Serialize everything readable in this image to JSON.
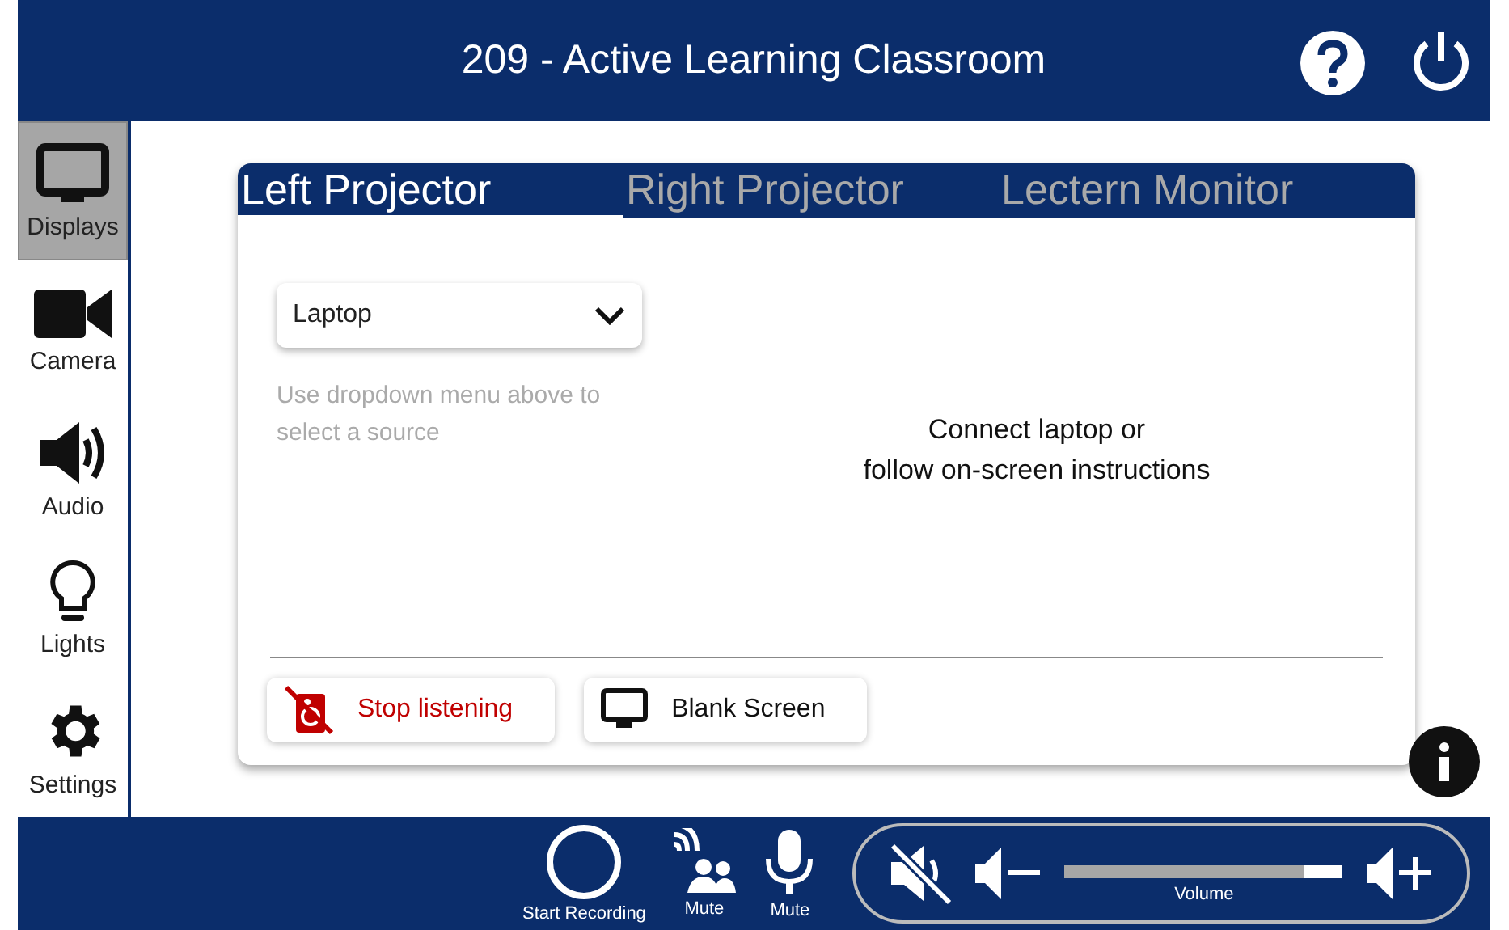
{
  "header": {
    "title": "209 - Active Learning Classroom"
  },
  "sidebar": {
    "items": [
      {
        "kind": "display",
        "label": "Displays",
        "selected": true
      },
      {
        "kind": "camera",
        "label": "Camera",
        "selected": false
      },
      {
        "kind": "audio",
        "label": "Audio",
        "selected": false
      },
      {
        "kind": "lights",
        "label": "Lights",
        "selected": false
      },
      {
        "kind": "settings",
        "label": "Settings",
        "selected": false
      }
    ]
  },
  "tabs": [
    {
      "label": "Left Projector",
      "selected": true
    },
    {
      "label": "Right Projector",
      "selected": false
    },
    {
      "label": "Lectern Monitor",
      "selected": false
    }
  ],
  "source": {
    "value": "Laptop",
    "hint": "Use dropdown menu above to select a source"
  },
  "message": [
    "Connect laptop or",
    "follow on-screen instructions"
  ],
  "actions": [
    {
      "kind": "stop-listening",
      "label": "Stop listening"
    },
    {
      "kind": "blank",
      "label": "Blank Screen"
    }
  ],
  "footer": {
    "controls": [
      {
        "kind": "record",
        "label": "Start Recording"
      },
      {
        "kind": "mute-room",
        "label": "Mute"
      },
      {
        "kind": "mute-mic",
        "label": "Mute"
      }
    ],
    "volume": {
      "label": "Volume",
      "level": 0.86,
      "muted": true
    }
  }
}
